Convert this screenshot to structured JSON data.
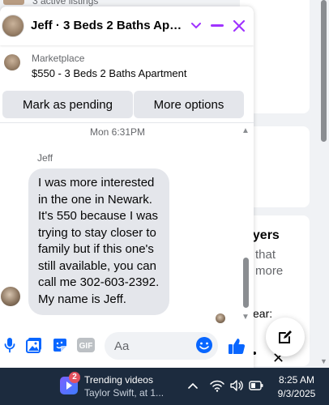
{
  "background_page": {
    "partial_text_top": "3 active listings",
    "section_heading_partial": "ayers",
    "line_1_partial": "that",
    "line_2_partial": "more",
    "line_3_partial": "ear:"
  },
  "chat": {
    "header_title": "Jeff · 3 Beds 2 Baths Apart...",
    "listing": {
      "source": "Marketplace",
      "name": "$550 - 3 Beds 2 Baths Apartment",
      "mark_pending_label": "Mark as pending",
      "more_options_label": "More options"
    },
    "timestamp": "Mon 6:31PM",
    "sender_name": "Jeff",
    "message_text": "I was more interested in the one in Newark. It's 550 because I was trying to stay closer to family but if this one's still available, you can call me 302-603-2392. My name is Jeff.",
    "composer": {
      "placeholder": "Aa",
      "gif_label": "GIF"
    }
  },
  "taskbar": {
    "widget_badge": "2",
    "widget_title": "Trending videos",
    "widget_subtitle": "Taylor Swift, at 1...",
    "time": "8:25 AM",
    "date": "9/3/2025"
  },
  "colors": {
    "accent": "#0866ff",
    "header_icon_purple": "#a033ff",
    "bubble": "#e4e6eb",
    "taskbar": "#1c2b3e"
  }
}
